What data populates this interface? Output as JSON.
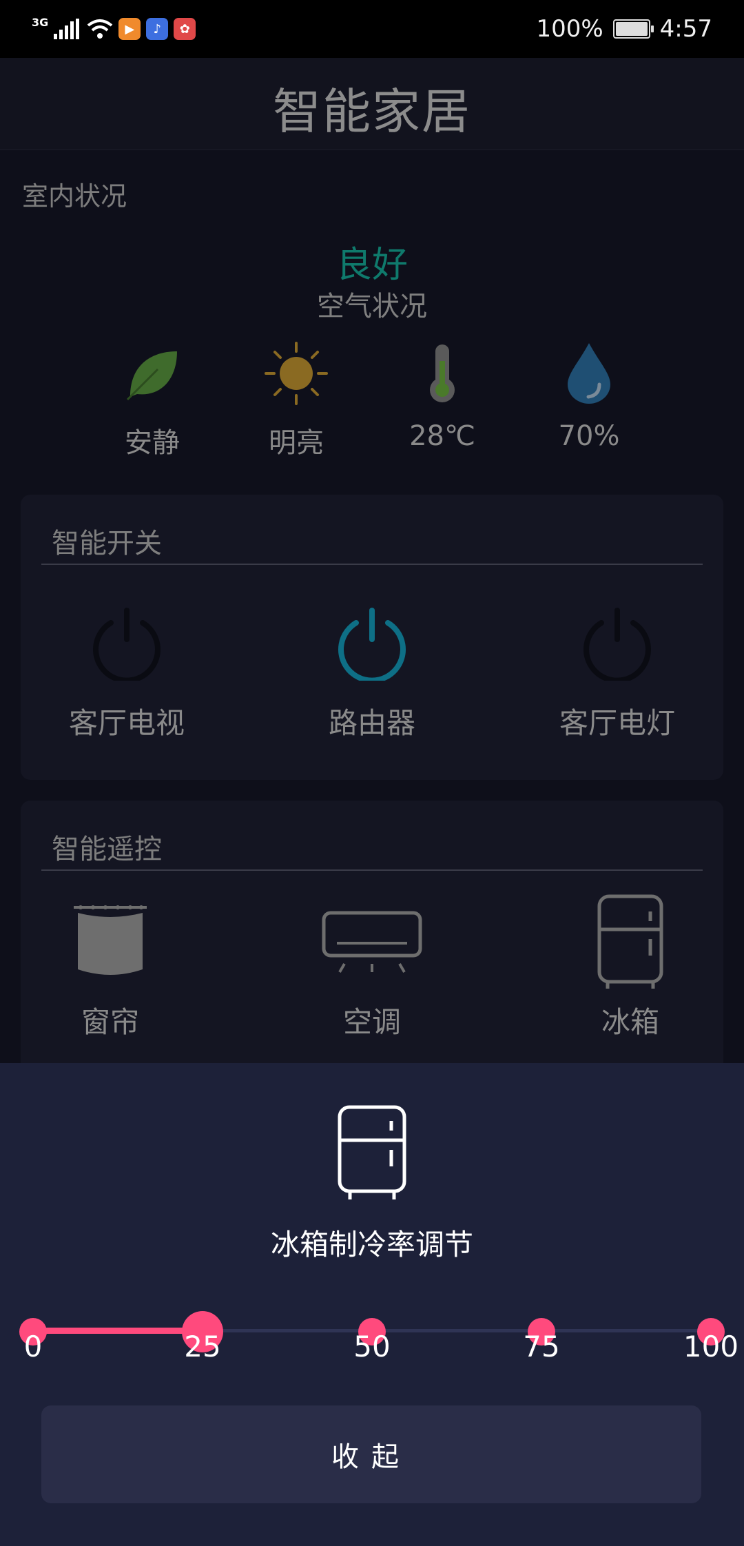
{
  "status_bar": {
    "network": "3G",
    "battery": "100%",
    "time": "4:57"
  },
  "header": {
    "title": "智能家居"
  },
  "indoor": {
    "label": "室内状况",
    "air_quality": "良好",
    "air_caption": "空气状况",
    "metrics": [
      {
        "icon": "leaf-icon",
        "label": "安静"
      },
      {
        "icon": "sun-icon",
        "label": "明亮"
      },
      {
        "icon": "thermometer-icon",
        "label": "28℃"
      },
      {
        "icon": "water-drop-icon",
        "label": "70%"
      }
    ]
  },
  "smart_switch": {
    "title": "智能开关",
    "items": [
      {
        "label": "客厅电视",
        "on": false
      },
      {
        "label": "路由器",
        "on": true
      },
      {
        "label": "客厅电灯",
        "on": false
      }
    ]
  },
  "smart_remote": {
    "title": "智能遥控",
    "items": [
      {
        "icon": "curtain-icon",
        "label": "窗帘"
      },
      {
        "icon": "air-conditioner-icon",
        "label": "空调"
      },
      {
        "icon": "fridge-icon",
        "label": "冰箱"
      }
    ]
  },
  "sheet": {
    "icon": "fridge-icon",
    "title": "冰箱制冷率调节",
    "slider": {
      "value": 25,
      "min": 0,
      "max": 100,
      "ticks": [
        "0",
        "25",
        "50",
        "75",
        "100"
      ]
    },
    "collapse_label": "收起"
  },
  "colors": {
    "accent_pink": "#ff4a7d",
    "air_good": "#0f7a6c",
    "switch_on": "#0e6f86",
    "sheet_bg": "#1d2139"
  }
}
